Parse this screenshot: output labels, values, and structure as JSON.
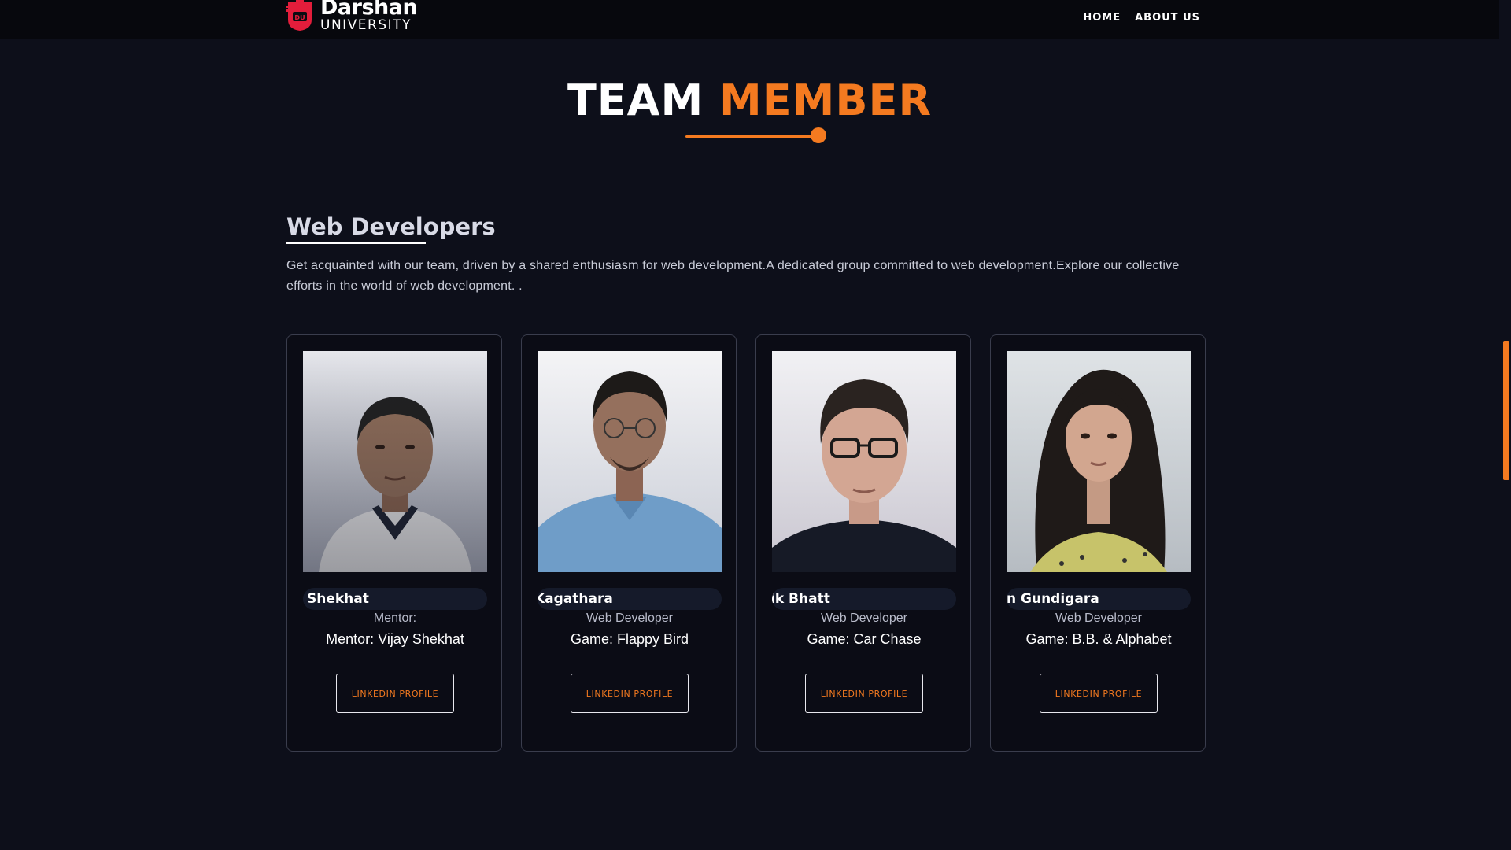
{
  "brand": {
    "name": "Darshan",
    "sub": "UNIVERSITY",
    "color": "#e31d3b"
  },
  "nav": {
    "items": [
      {
        "label": "HOME"
      },
      {
        "label": "ABOUT US"
      }
    ]
  },
  "section": {
    "title_part1": "TEAM",
    "title_part2": "MEMBER",
    "accent": "#f47a20"
  },
  "group": {
    "heading": "Web Developers",
    "intro": "Get acquainted with our team, driven by a shared enthusiasm for web development.A dedicated group committed to web development.Explore our collective efforts in the world of web development. ."
  },
  "members": [
    {
      "name": "Shekhat",
      "role": "Mentor:",
      "game": "Mentor: Vijay Shekhat",
      "button": "LINKEDIN PROFILE",
      "photo": "mentor-photo"
    },
    {
      "name": "Kagathara",
      "role": "Web Developer",
      "game": "Game: Flappy Bird",
      "button": "LINKEDIN PROFILE",
      "photo": "developer-photo"
    },
    {
      "name": "ik Bhatt",
      "role": "Web Developer",
      "game": "Game: Car Chase",
      "button": "LINKEDIN PROFILE",
      "photo": "developer-photo"
    },
    {
      "name": "n Gundigara",
      "role": "Web Developer",
      "game": "Game: B.B. & Alphabet",
      "button": "LINKEDIN PROFILE",
      "photo": "developer-photo"
    }
  ]
}
